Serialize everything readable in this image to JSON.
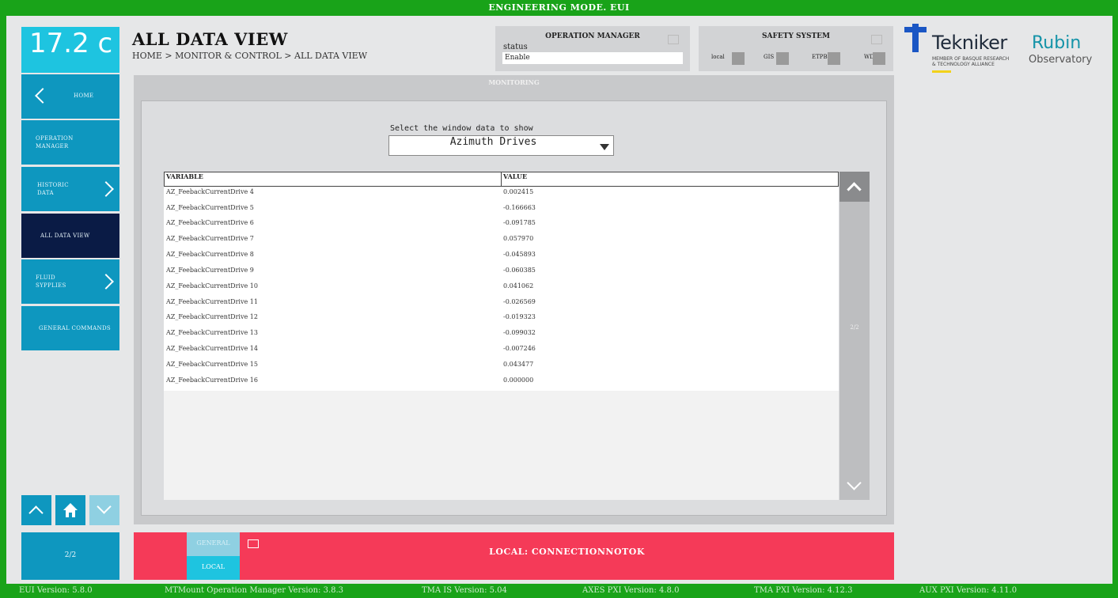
{
  "window": {
    "title": "ENGINEERING MODE. EUI"
  },
  "temperature": "17.2 c",
  "nav": {
    "home": "HOME",
    "operation_manager": "OPERATION\nMANAGER",
    "operation_manager_l1": "OPERATION",
    "operation_manager_l2": "MANAGER",
    "historic_l1": "HISTORIC",
    "historic_l2": "DATA",
    "all_data_view": "ALL DATA VIEW",
    "fluid_l1": "FLUID",
    "fluid_l2": "SYPPLIES",
    "general_commands": "GENERAL COMMANDS",
    "page": "2/2"
  },
  "header": {
    "title": "ALL DATA VIEW",
    "breadcrumb": "HOME > MONITOR & CONTROL > ALL DATA VIEW"
  },
  "operation_manager": {
    "title": "OPERATION MANAGER",
    "status_label": "status",
    "status_value": "Enable"
  },
  "safety": {
    "title": "SAFETY SYSTEM",
    "items": [
      "local",
      "GIS",
      "ETPB",
      "WD"
    ]
  },
  "logos": {
    "tekniker": "Tekniker",
    "tekniker_sub1": "MEMBER OF BASQUE RESEARCH",
    "tekniker_sub2": "& TECHNOLOGY ALLIANCE",
    "rubin1": "Rubin",
    "rubin2": "Observatory"
  },
  "monitoring": {
    "title": "MONITORING",
    "select_label": "Select the window data to show",
    "selected": "Azimuth Drives",
    "columns": [
      "VARIABLE",
      "VALUE"
    ],
    "rows": [
      [
        "AZ_FeebackCurrentDrive 4",
        "0.002415"
      ],
      [
        "AZ_FeebackCurrentDrive 5",
        "-0.166663"
      ],
      [
        "AZ_FeebackCurrentDrive 6",
        "-0.091785"
      ],
      [
        "AZ_FeebackCurrentDrive 7",
        "0.057970"
      ],
      [
        "AZ_FeebackCurrentDrive 8",
        "-0.045893"
      ],
      [
        "AZ_FeebackCurrentDrive 9",
        "-0.060385"
      ],
      [
        "AZ_FeebackCurrentDrive 10",
        "0.041062"
      ],
      [
        "AZ_FeebackCurrentDrive 11",
        "-0.026569"
      ],
      [
        "AZ_FeebackCurrentDrive 12",
        "-0.019323"
      ],
      [
        "AZ_FeebackCurrentDrive 13",
        "-0.099032"
      ],
      [
        "AZ_FeebackCurrentDrive 14",
        "-0.007246"
      ],
      [
        "AZ_FeebackCurrentDrive 15",
        "0.043477"
      ],
      [
        "AZ_FeebackCurrentDrive 16",
        "0.000000"
      ]
    ],
    "page": "2/2"
  },
  "bottom": {
    "general": "GENERAL",
    "local": "LOCAL",
    "connection": "LOCAL: CONNECTIONNOTOK"
  },
  "footer": {
    "eui": "EUI Version: 5.8.0",
    "mtmount": "MTMount Operation Manager Version: 3.8.3",
    "tma_is": "TMA IS Version: 5.04",
    "axes_pxi": "AXES PXI Version: 4.8.0",
    "tma_pxi": "TMA PXI Version: 4.12.3",
    "aux_pxi": "AUX PXI Version: 4.11.0"
  },
  "colors": {
    "green_frame": "#19a319",
    "nav_blue": "#0e97bf",
    "nav_active": "#0a1b45",
    "alert_red": "#f53a58",
    "cyan": "#1ec4e0"
  }
}
